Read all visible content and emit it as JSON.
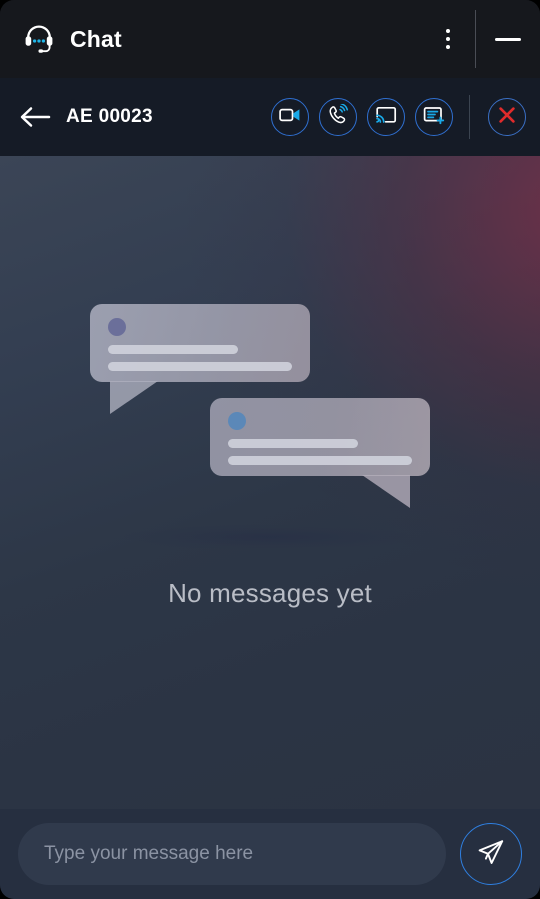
{
  "window": {
    "title_bar": {
      "app_title": "Chat",
      "brand_icon": "headset-icon",
      "menu_icon": "kebab-menu-icon",
      "minimize_icon": "minimize-icon"
    },
    "action_toolbar": {
      "back_icon": "back-arrow-icon",
      "conversation_id": "AE 00023",
      "actions": [
        {
          "name": "video-call-button",
          "icon": "video-camera-icon"
        },
        {
          "name": "phone-call-button",
          "icon": "ringing-phone-icon"
        },
        {
          "name": "screen-share-button",
          "icon": "screen-cast-icon"
        },
        {
          "name": "add-note-button",
          "icon": "add-note-icon"
        },
        {
          "name": "end-session-button",
          "icon": "close-x-icon"
        }
      ]
    },
    "message_area": {
      "empty_state_text": "No messages yet",
      "illustration": {
        "name": "chat-bubbles-illustration",
        "bubbles": [
          {
            "name": "bubble-one",
            "avatar_color": "#6b6f9a",
            "lines": 2
          },
          {
            "name": "bubble-two",
            "avatar_color": "#5b88b8",
            "lines": 2
          }
        ]
      }
    },
    "composer": {
      "input_placeholder": "Type your message here",
      "input_value": "",
      "send_icon": "send-paper-plane-icon"
    }
  },
  "colors": {
    "title_bar_bg": "#16181d",
    "toolbar_bg": "#151b26",
    "accent_blue": "#2f7fe0",
    "accent_cyan": "#1fa8e0",
    "danger_red": "#e02b2b",
    "composer_bg": "#262f40",
    "input_bg": "#303a4c",
    "empty_text": "#b9bdc6"
  }
}
